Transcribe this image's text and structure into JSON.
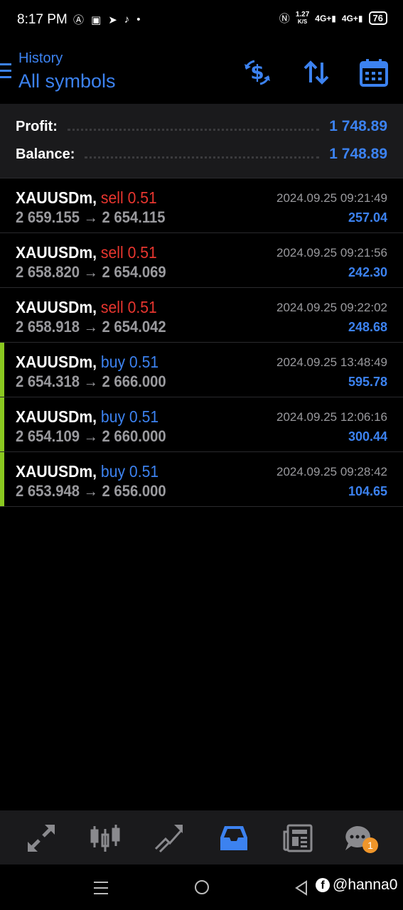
{
  "status_bar": {
    "time": "8:17 PM",
    "net_speed_value": "1.27",
    "net_speed_unit": "K/S",
    "sim1": "4G+",
    "sim2": "4G+",
    "battery": "76"
  },
  "header": {
    "subtitle": "History",
    "title": "All symbols"
  },
  "summary": {
    "profit_label": "Profit:",
    "profit_value": "1 748.89",
    "balance_label": "Balance:",
    "balance_value": "1 748.89"
  },
  "trades": [
    {
      "symbol": "XAUUSDm,",
      "side": "sell",
      "volume": "0.51",
      "open": "2 659.155",
      "close": "2 654.115",
      "time": "2024.09.25 09:21:49",
      "profit": "257.04"
    },
    {
      "symbol": "XAUUSDm,",
      "side": "sell",
      "volume": "0.51",
      "open": "2 658.820",
      "close": "2 654.069",
      "time": "2024.09.25 09:21:56",
      "profit": "242.30"
    },
    {
      "symbol": "XAUUSDm,",
      "side": "sell",
      "volume": "0.51",
      "open": "2 658.918",
      "close": "2 654.042",
      "time": "2024.09.25 09:22:02",
      "profit": "248.68"
    },
    {
      "symbol": "XAUUSDm,",
      "side": "buy",
      "volume": "0.51",
      "open": "2 654.318",
      "close": "2 666.000",
      "time": "2024.09.25 13:48:49",
      "profit": "595.78"
    },
    {
      "symbol": "XAUUSDm,",
      "side": "buy",
      "volume": "0.51",
      "open": "2 654.109",
      "close": "2 660.000",
      "time": "2024.09.25 12:06:16",
      "profit": "300.44"
    },
    {
      "symbol": "XAUUSDm,",
      "side": "buy",
      "volume": "0.51",
      "open": "2 653.948",
      "close": "2 656.000",
      "time": "2024.09.25 09:28:42",
      "profit": "104.65"
    }
  ],
  "arrow": "→",
  "bottom_nav": {
    "active": "history",
    "chat_badge": "1",
    "items": [
      "quotes-icon",
      "chart-icon",
      "trade-icon",
      "history-icon",
      "news-icon",
      "messages-icon"
    ]
  },
  "watermark": "@hanna0",
  "colors": {
    "accent": "#3c82f0",
    "sell": "#e8362f",
    "buy_bar": "#8ac820",
    "badge": "#f0962a"
  }
}
